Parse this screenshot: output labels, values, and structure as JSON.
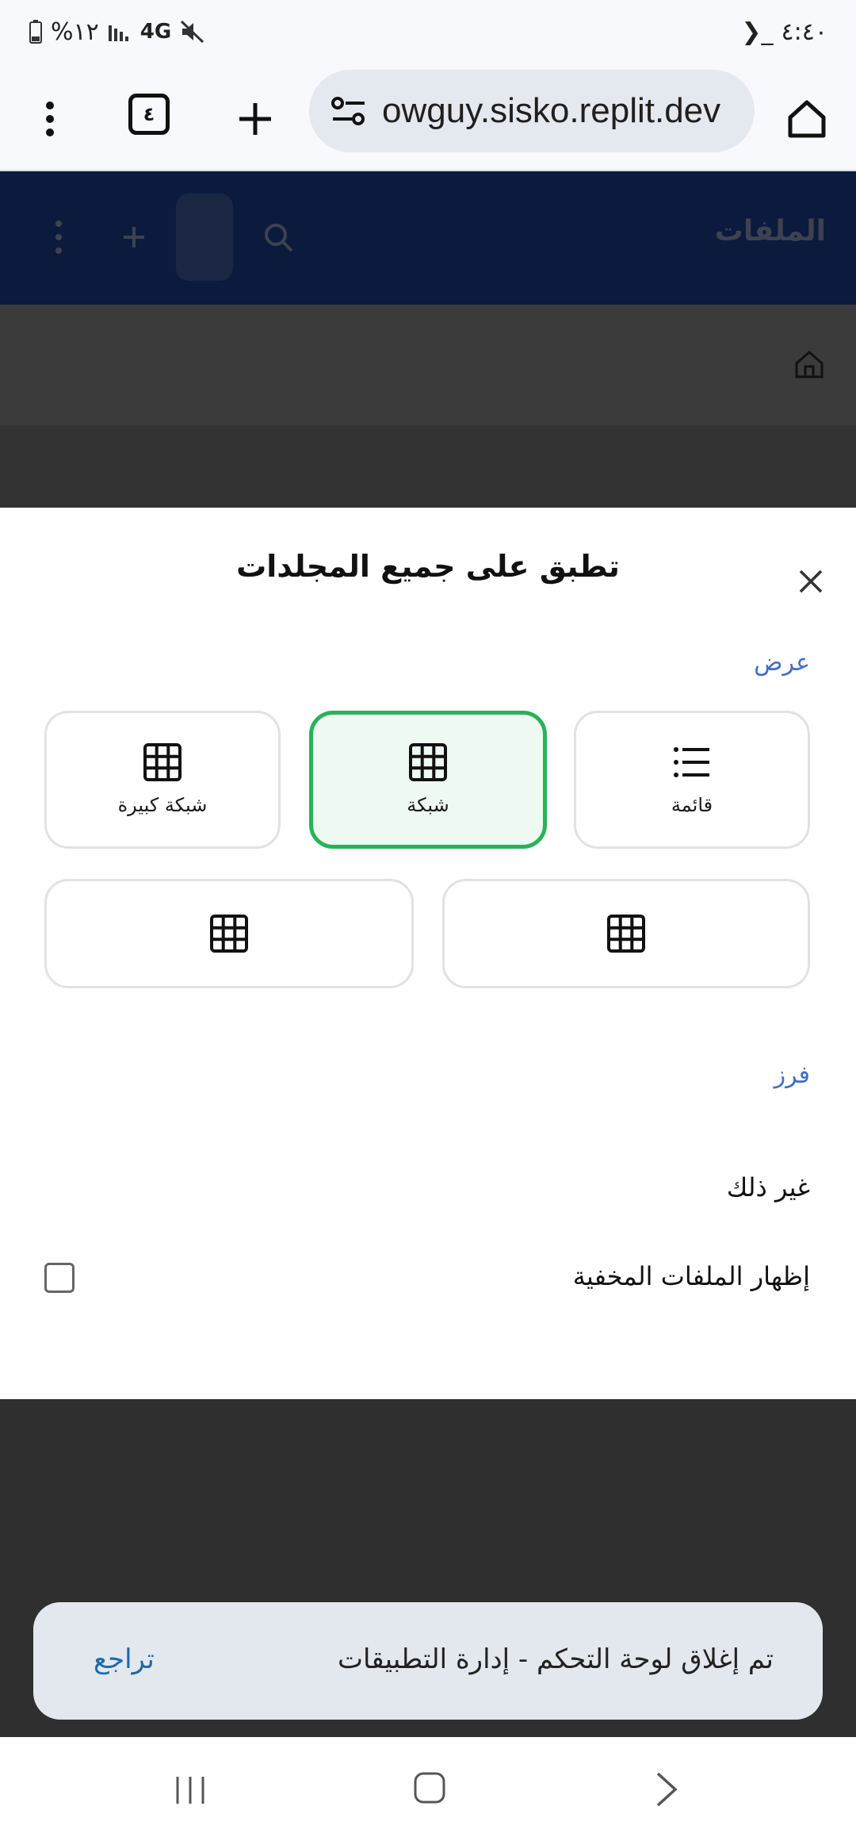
{
  "status_bar": {
    "time": "٤:٤٠",
    "terminal_glyph": "❯_",
    "battery": "%١٢",
    "network": "4G"
  },
  "browser": {
    "tab_count": "٤",
    "url": "owguy.sisko.replit.dev"
  },
  "app_header": {
    "title": "الملفات"
  },
  "sheet": {
    "title": "تطبق على جميع المجلدات",
    "view_section_label": "عرض",
    "view_options": [
      {
        "label": "قائمة",
        "icon": "list-icon",
        "selected": false
      },
      {
        "label": "شبكة",
        "icon": "grid-icon",
        "selected": true
      },
      {
        "label": "شبكة كبيرة",
        "icon": "grid-icon",
        "selected": false
      },
      {
        "label": "",
        "icon": "grid-icon",
        "selected": false
      },
      {
        "label": "",
        "icon": "grid-icon",
        "selected": false
      }
    ],
    "sort_section_label": "فرز",
    "other_label": "غير ذلك",
    "show_hidden_label": "إظهار الملفات المخفية",
    "show_hidden_checked": false
  },
  "snackbar": {
    "message": "تم إغلاق لوحة التحكم - إدارة التطبيقات",
    "action": "تراجع"
  },
  "colors": {
    "header_bg": "#0c1a3e",
    "selected_border": "#27b35a",
    "selected_bg": "#edf9f1",
    "section_label": "#3f6fc9",
    "snackbar_action": "#1e6aa8"
  }
}
